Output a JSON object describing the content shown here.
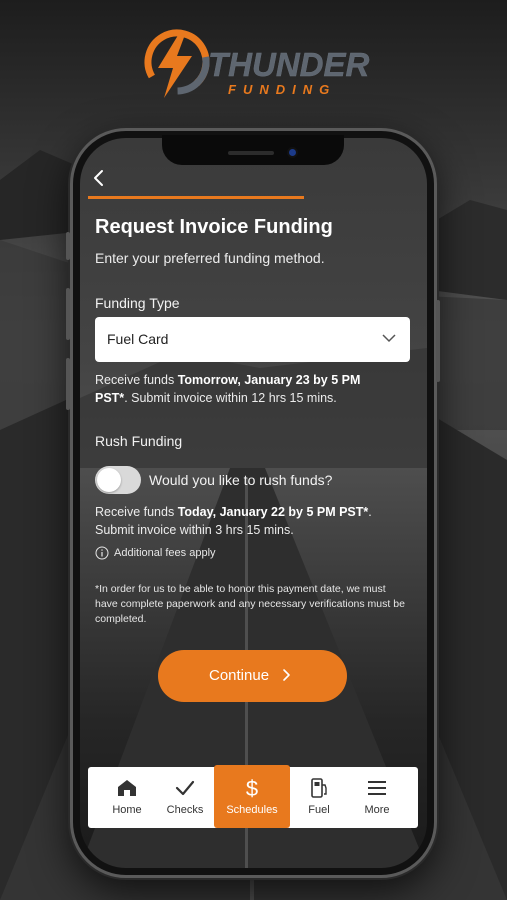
{
  "brand": {
    "title": "THUNDER",
    "subtitle": "FUNDING",
    "accent_color": "#e8791e",
    "icon": "lightning-bolt-icon"
  },
  "screen": {
    "back_icon": "chevron-left-icon",
    "progress": 0.65,
    "title": "Request Invoice Funding",
    "subtitle": "Enter your preferred funding method.",
    "funding_type": {
      "label": "Funding Type",
      "selected": "Fuel Card",
      "icon": "chevron-down-icon"
    },
    "standard_info": {
      "prefix": "Receive funds ",
      "bold": "Tomorrow, January 23 by 5 PM PST*",
      "suffix": ". Submit invoice within 12 hrs 15 mins."
    },
    "rush": {
      "label": "Rush Funding",
      "toggle_label": "Would you like to rush funds?",
      "toggle_on": false,
      "info_prefix": "Receive funds ",
      "info_bold": "Today, January 22 by 5 PM PST*",
      "info_suffix": ". Submit invoice within 3 hrs 15 mins.",
      "fee_icon": "info-icon",
      "fee_text": "Additional fees apply"
    },
    "note": "*In order for us to be able to honor this payment date, we must have complete paperwork and any necessary verifications must be completed.",
    "continue_label": "Continue",
    "continue_icon": "chevron-right-icon"
  },
  "nav": {
    "items": [
      {
        "label": "Home",
        "icon": "home-icon",
        "active": false
      },
      {
        "label": "Checks",
        "icon": "checkmark-icon",
        "active": false
      },
      {
        "label": "Schedules",
        "icon": "dollar-icon",
        "active": true
      },
      {
        "label": "Fuel",
        "icon": "fuel-pump-icon",
        "active": false
      },
      {
        "label": "More",
        "icon": "menu-icon",
        "active": false
      }
    ]
  }
}
